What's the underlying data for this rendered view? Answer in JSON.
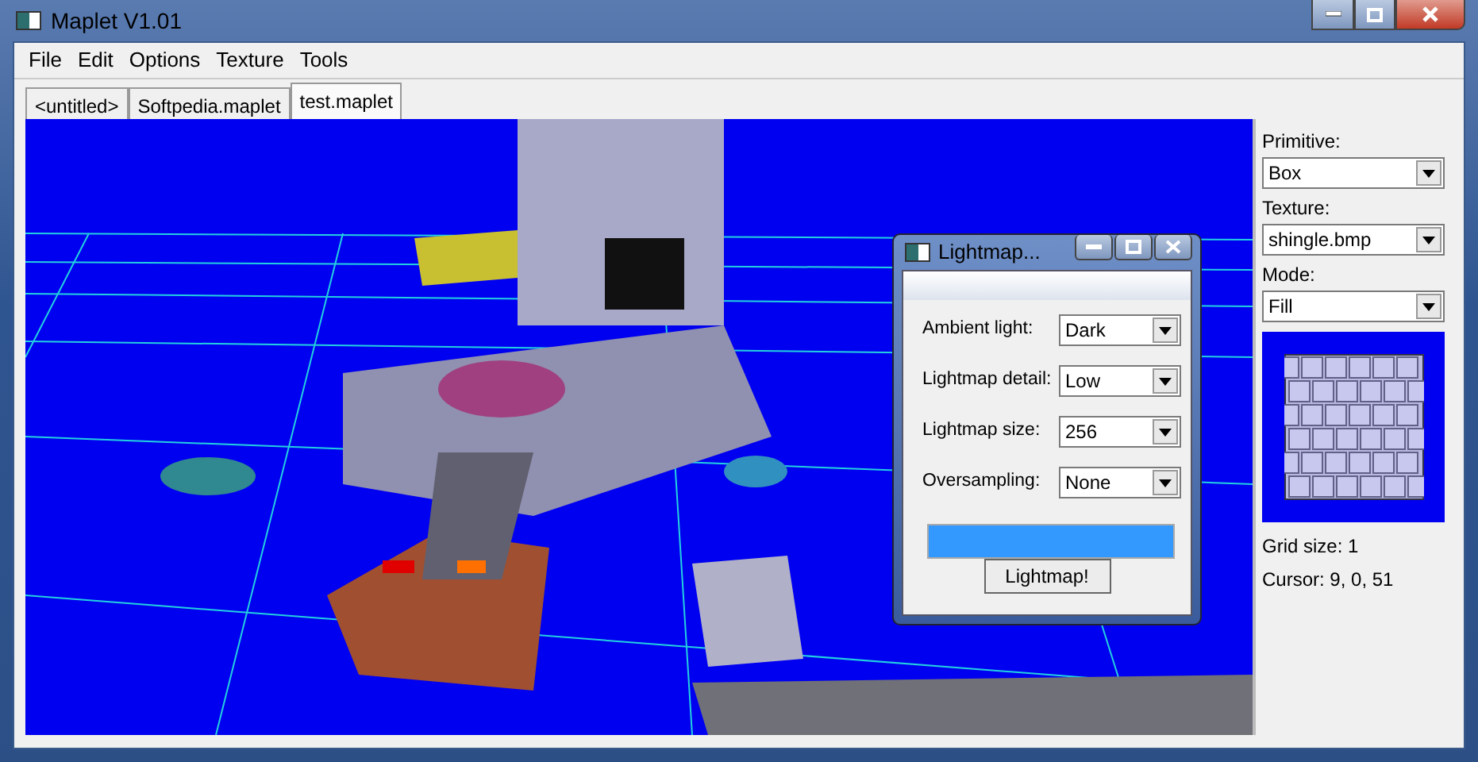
{
  "window": {
    "title": "Maplet V1.01"
  },
  "menu": [
    "File",
    "Edit",
    "Options",
    "Texture",
    "Tools"
  ],
  "tabs": [
    {
      "label": "<untitled>",
      "selected": false
    },
    {
      "label": "Softpedia.maplet",
      "selected": false
    },
    {
      "label": "test.maplet",
      "selected": true
    }
  ],
  "sidebar": {
    "fields": [
      {
        "label": "Primitive:",
        "value": "Box"
      },
      {
        "label": "Texture:",
        "value": "shingle.bmp"
      },
      {
        "label": "Mode:",
        "value": "Fill"
      }
    ],
    "grid_size": "Grid size: 1",
    "cursor": "Cursor: 9, 0, 51"
  },
  "dialog": {
    "title": "Lightmap...",
    "fields": [
      {
        "label": "Ambient light:",
        "value": "Dark"
      },
      {
        "label": "Lightmap detail:",
        "value": "Low"
      },
      {
        "label": "Lightmap size:",
        "value": "256"
      },
      {
        "label": "Oversampling:",
        "value": "None"
      }
    ],
    "progress": {
      "level": 1.0
    },
    "button": "Lightmap!"
  }
}
